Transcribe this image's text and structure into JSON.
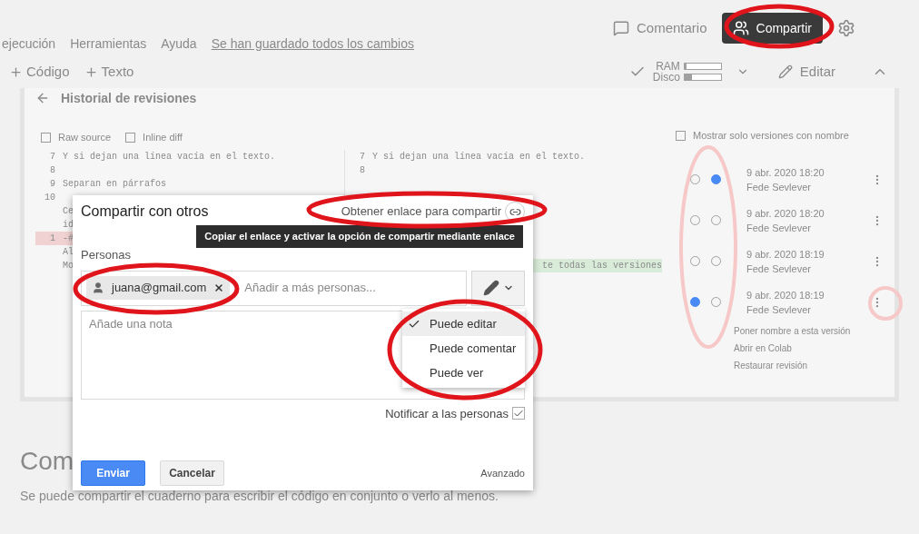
{
  "toolbar": {
    "comment_button": "Comentario",
    "share_button": "Compartir"
  },
  "menu": [
    "ejecución",
    "Herramientas",
    "Ayuda"
  ],
  "save_status": "Se han guardado todos los cambios",
  "cell_buttons": [
    "Código",
    "Texto"
  ],
  "resources": [
    {
      "label": "RAM",
      "level": 0.05
    },
    {
      "label": "Disco",
      "level": 0.2
    }
  ],
  "edit_button": "Editar",
  "history": {
    "title": "Historial de revisiones",
    "options": [
      {
        "label": "Raw source",
        "checked": false
      },
      {
        "label": "Inline diff",
        "checked": false
      }
    ],
    "left_lines": [
      {
        "number": "7",
        "text": "Y si dejan una línea vacía en el texto."
      },
      {
        "number": "8"
      },
      {
        "number": "9",
        "text": "Separan en párrafos"
      },
      {
        "number": "10"
      },
      {
        "text": "Ce"
      },
      {
        "text": "id"
      },
      {
        "number": "1",
        "text": "-#",
        "removed": true
      },
      {
        "text": "Al"
      },
      {
        "text": "Mo"
      }
    ],
    "right_lines": [
      {
        "number": "7",
        "text": "Y si dejan una línea vacía en el texto."
      },
      {
        "number": "8"
      },
      {
        "text": "te todas las versiones",
        "added": true
      }
    ],
    "named_only": {
      "label": "Mostrar solo versiones con nombre",
      "checked": false
    },
    "revisions": [
      {
        "date": "9 abr. 2020 18:20",
        "author": "Fede Sevlever",
        "from_selected": false,
        "to_selected": true
      },
      {
        "date": "9 abr. 2020 18:20",
        "author": "Fede Sevlever",
        "from_selected": false,
        "to_selected": false
      },
      {
        "date": "9 abr. 2020 18:19",
        "author": "Fede Sevlever",
        "from_selected": false,
        "to_selected": false
      },
      {
        "date": "9 abr. 2020 18:19",
        "author": "Fede Sevlever",
        "from_selected": true,
        "to_selected": false
      }
    ],
    "revision_menu": [
      "Poner nombre a esta versión",
      "Abrir en Colab",
      "Restaurar revisión"
    ]
  },
  "section": {
    "heading": "Com",
    "text": "Se puede compartir el cuaderno para escribir el código en conjunto o verlo al menos."
  },
  "share_dialog": {
    "title": "Compartir con otros",
    "link_button": "Obtener enlace para compartir",
    "tooltip": "Copiar el enlace y activar la opción de compartir mediante enlace",
    "people_label": "Personas",
    "chips": [
      "juana@gmail.com"
    ],
    "people_placeholder": "Añadir a más personas...",
    "note_placeholder": "Añade una nota",
    "permissions": [
      {
        "label": "Puede editar",
        "selected": true
      },
      {
        "label": "Puede comentar",
        "selected": false
      },
      {
        "label": "Puede ver",
        "selected": false
      }
    ],
    "notify": {
      "label": "Notificar a las personas",
      "checked": true
    },
    "send_button": "Enviar",
    "cancel_button": "Cancelar",
    "advanced_link": "Avanzado"
  }
}
